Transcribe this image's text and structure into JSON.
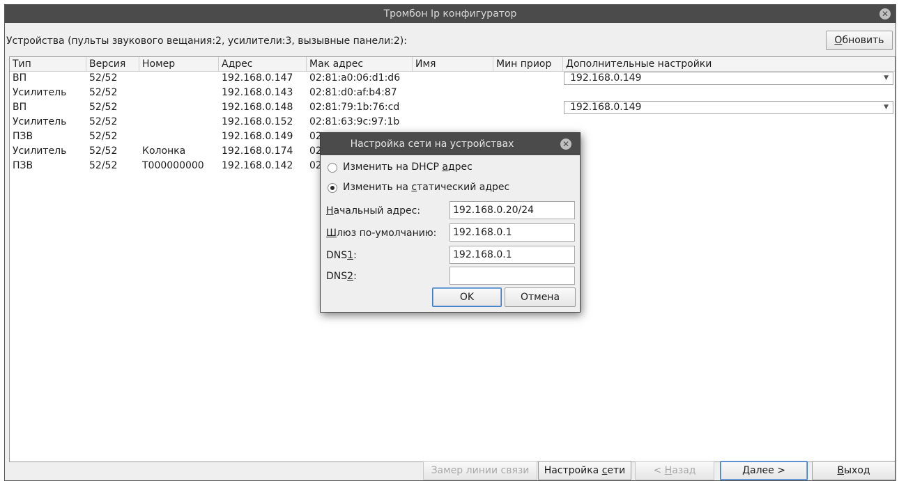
{
  "window": {
    "title": "Тромбон Ip конфигуратор"
  },
  "devices_label": "Устройства (пульты звукового вещания:2, усилители:3, вызывные панели:2):",
  "refresh_button": {
    "pre": "",
    "key": "О",
    "post": "бновить"
  },
  "table": {
    "columns": [
      "Тип",
      "Версия",
      "Номер",
      "Адрес",
      "Мак адрес",
      "Имя",
      "Мин приор",
      "Дополнительные настройки"
    ],
    "rows": [
      {
        "type": "ВП",
        "version": "52/52",
        "number": "",
        "address": "192.168.0.147",
        "mac": "02:81:a0:06:d1:d6",
        "name": "",
        "min_prio": "",
        "extra": "192.168.0.149"
      },
      {
        "type": "Усилитель",
        "version": "52/52",
        "number": "",
        "address": "192.168.0.143",
        "mac": "02:81:d0:af:b4:87",
        "name": "",
        "min_prio": "",
        "extra": ""
      },
      {
        "type": "ВП",
        "version": "52/52",
        "number": "",
        "address": "192.168.0.148",
        "mac": "02:81:79:1b:76:cd",
        "name": "",
        "min_prio": "",
        "extra": "192.168.0.149"
      },
      {
        "type": "Усилитель",
        "version": "52/52",
        "number": "",
        "address": "192.168.0.152",
        "mac": "02:81:63:9c:97:1b",
        "name": "",
        "min_prio": "",
        "extra": ""
      },
      {
        "type": "ПЗВ",
        "version": "52/52",
        "number": "",
        "address": "192.168.0.149",
        "mac": "02",
        "name": "",
        "min_prio": "",
        "extra": ""
      },
      {
        "type": "Усилитель",
        "version": "52/52",
        "number": "Колонка",
        "address": "192.168.0.174",
        "mac": "02",
        "name": "",
        "min_prio": "",
        "extra": ""
      },
      {
        "type": "ПЗВ",
        "version": "52/52",
        "number": "T000000000",
        "address": "192.168.0.142",
        "mac": "02",
        "name": "",
        "min_prio": "",
        "extra": ""
      }
    ]
  },
  "dialog": {
    "title": "Настройка сети на устройствах",
    "radio_dhcp": {
      "pre": "Изменить на DHCP ",
      "key": "а",
      "post": "дрес",
      "checked": false
    },
    "radio_static": {
      "pre": "Изменить на ",
      "key": "с",
      "post": "татический адрес",
      "checked": true
    },
    "start_address": {
      "pre": "",
      "key": "Н",
      "post": "ачальный адрес:",
      "value": "192.168.0.20/24"
    },
    "gateway": {
      "pre": "",
      "key": "Ш",
      "post": "люз по-умолчанию:",
      "value": "192.168.0.1"
    },
    "dns1": {
      "pre": "DNS",
      "key": "1",
      "post": ":",
      "value": "192.168.0.1"
    },
    "dns2": {
      "pre": "DNS",
      "key": "2",
      "post": ":",
      "value": ""
    },
    "ok_label": "OK",
    "cancel_label": "Отмена"
  },
  "bottom": {
    "measure": "Замер линии связи",
    "network": {
      "pre": "Настройка ",
      "key": "с",
      "post": "ети"
    },
    "back": {
      "pre": "< ",
      "key": "Н",
      "post": "азад"
    },
    "next": {
      "pre": "",
      "key": "Д",
      "post": "алее >"
    },
    "exit": {
      "pre": "",
      "key": "В",
      "post": "ыход"
    }
  }
}
